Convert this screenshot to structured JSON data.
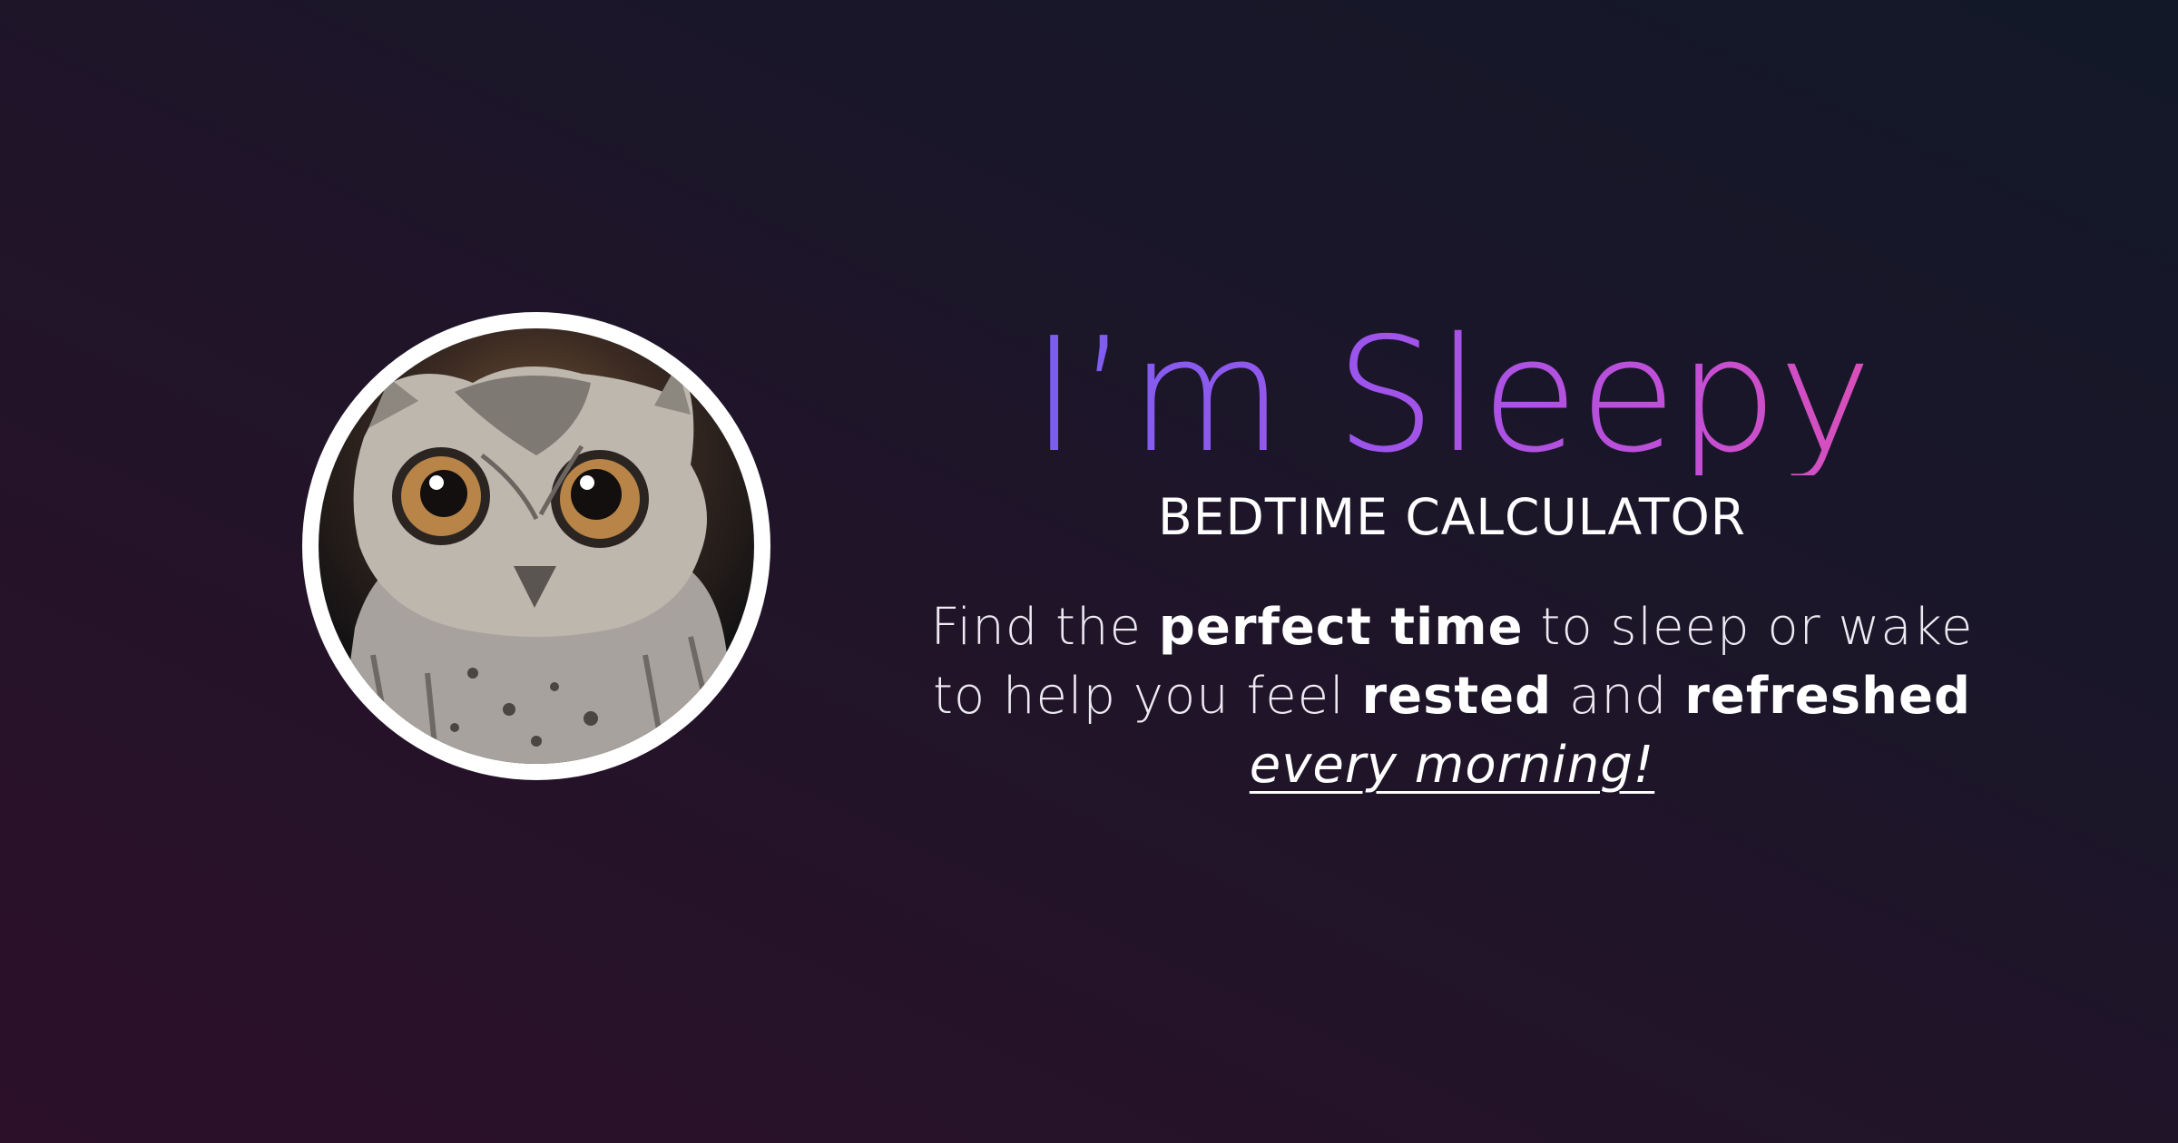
{
  "hero": {
    "title": "I’m Sleepy",
    "subtitle": "BEDTIME CALCULATOR",
    "description": {
      "line1": {
        "part1": "Find the ",
        "bold1": "perfect time",
        "part2": " to sleep or wake"
      },
      "line2": {
        "part1": "to help you feel ",
        "bold1": "rested",
        "part2": " and ",
        "bold2": "refreshed"
      },
      "line3": {
        "emphasis": "every morning!"
      }
    }
  },
  "avatar": {
    "icon": "owl-icon"
  },
  "colors": {
    "background_start": "#2c1029",
    "background_end": "#121828",
    "title_gradient_start": "#6b63f2",
    "title_gradient_mid": "#9a55ee",
    "title_gradient_end": "#ea4fa5",
    "text": "#ffffff"
  }
}
